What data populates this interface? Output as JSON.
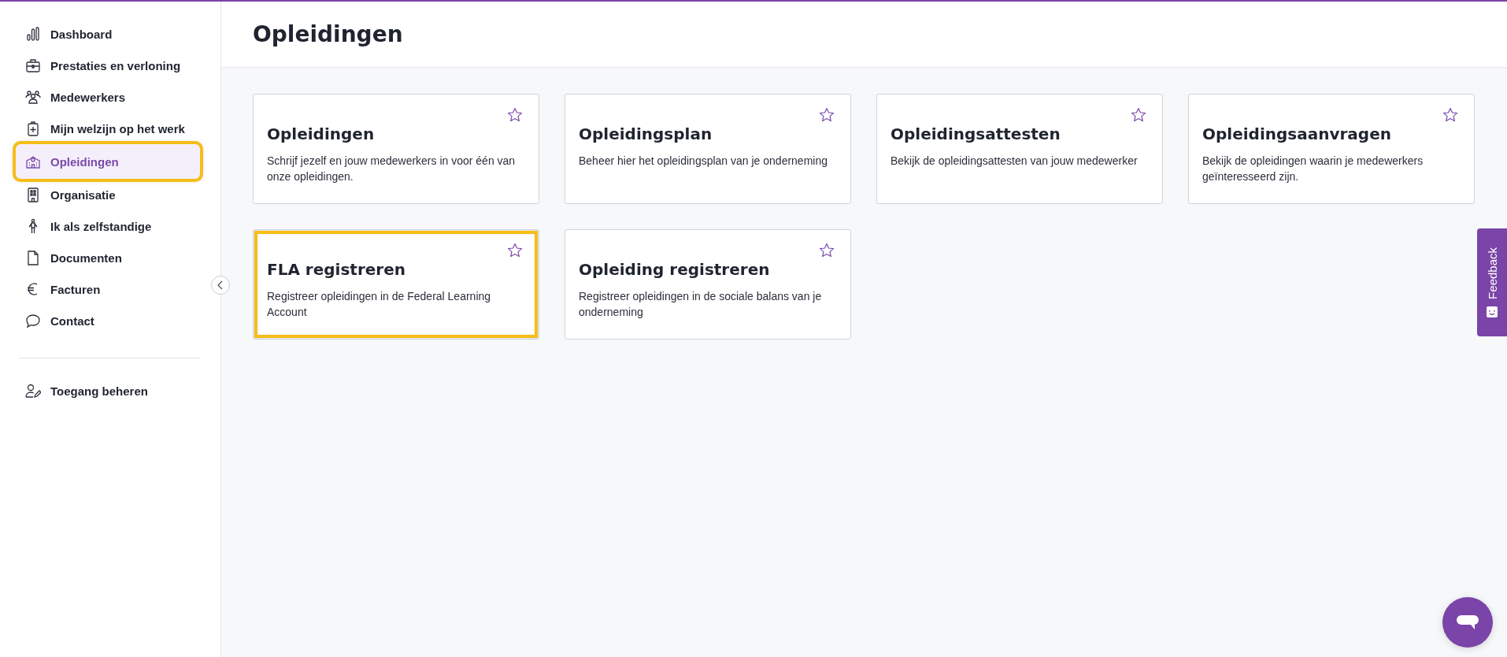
{
  "sidebar": {
    "items": [
      {
        "label": "Dashboard",
        "selected": false,
        "highlighted": false
      },
      {
        "label": "Prestaties en verloning",
        "selected": false,
        "highlighted": false
      },
      {
        "label": "Medewerkers",
        "selected": false,
        "highlighted": false
      },
      {
        "label": "Mijn welzijn op het werk",
        "selected": false,
        "highlighted": false
      },
      {
        "label": "Opleidingen",
        "selected": true,
        "highlighted": true
      },
      {
        "label": "Organisatie",
        "selected": false,
        "highlighted": false
      },
      {
        "label": "Ik als zelfstandige",
        "selected": false,
        "highlighted": false
      },
      {
        "label": "Documenten",
        "selected": false,
        "highlighted": false
      },
      {
        "label": "Facturen",
        "selected": false,
        "highlighted": false
      },
      {
        "label": "Contact",
        "selected": false,
        "highlighted": false
      }
    ],
    "footer_items": [
      {
        "label": "Toegang beheren",
        "selected": false,
        "highlighted": false
      }
    ]
  },
  "page": {
    "title": "Opleidingen"
  },
  "cards": [
    {
      "title": "Opleidingen",
      "description": "Schrijf jezelf en jouw medewerkers in voor één van onze opleidingen.",
      "favorite": false,
      "highlighted": false
    },
    {
      "title": "Opleidingsplan",
      "description": "Beheer hier het opleidingsplan van je onderneming",
      "favorite": false,
      "highlighted": false
    },
    {
      "title": "Opleidingsattesten",
      "description": "Bekijk de opleidingsattesten van jouw medewerker",
      "favorite": false,
      "highlighted": false
    },
    {
      "title": "Opleidingsaanvragen",
      "description": "Bekijk de opleidingen waarin je medewerkers geïnteresseerd zijn.",
      "favorite": false,
      "highlighted": false
    },
    {
      "title": "FLA registreren",
      "description": "Registreer opleidingen in de Federal Learning Account",
      "favorite": false,
      "highlighted": true
    },
    {
      "title": "Opleiding registreren",
      "description": "Registreer opleidingen in de sociale balans van je onderneming",
      "favorite": false,
      "highlighted": false
    }
  ],
  "feedback_tab": {
    "label": "Feedback"
  }
}
